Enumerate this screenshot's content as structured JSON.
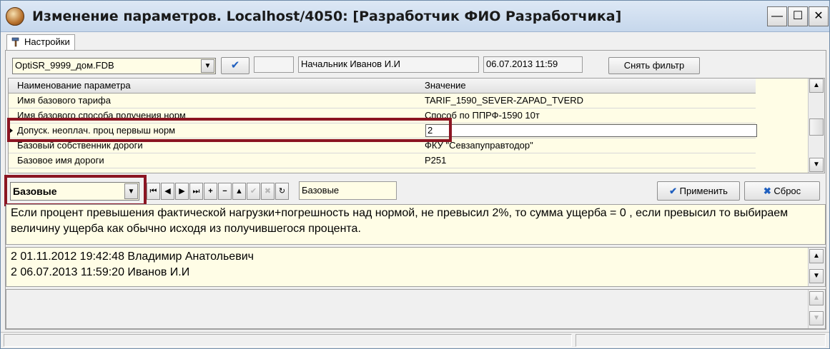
{
  "window": {
    "title": "Изменение параметров. Localhost/4050: [Разработчик ФИО Разработчика]",
    "minimize_glyph": "—",
    "maximize_glyph": "☐",
    "close_glyph": "✕"
  },
  "tabs": [
    {
      "label": "Настройки",
      "icon": "hammer-icon"
    }
  ],
  "toolbar": {
    "database_select": "OptiSR_9999_дом.FDB",
    "confirm_glyph": "✔",
    "empty_field": "",
    "user_field": "Начальник Иванов И.И",
    "datetime_field": "06.07.2013 11:59",
    "remove_filter_label": "Снять фильтр"
  },
  "grid": {
    "columns": [
      "Наименование параметра",
      "Значение"
    ],
    "rows": [
      {
        "name": "Имя базового тарифа",
        "value": "TARIF_1590_SEVER-ZAPAD_TVERD"
      },
      {
        "name": "Имя базового способа получения норм",
        "value": "Способ по ППРФ-1590 10т"
      },
      {
        "name": "Допуск. неоплач. проц первыш норм",
        "value": "2",
        "selected": true
      },
      {
        "name": "Базовый собственник дороги",
        "value": "ФКУ \"Севзапуправтодор\""
      },
      {
        "name": "Базовое имя дороги",
        "value": "Р251"
      }
    ]
  },
  "bottom_toolbar": {
    "group_select": "Базовые",
    "nav_buttons": [
      {
        "name": "first-record-button",
        "glyph": "⏮",
        "enabled": true
      },
      {
        "name": "prior-record-button",
        "glyph": "◀",
        "enabled": true
      },
      {
        "name": "next-record-button",
        "glyph": "▶",
        "enabled": true
      },
      {
        "name": "last-record-button",
        "glyph": "⏭",
        "enabled": true
      },
      {
        "name": "insert-record-button",
        "glyph": "+",
        "enabled": true
      },
      {
        "name": "delete-record-button",
        "glyph": "−",
        "enabled": true
      },
      {
        "name": "edit-record-button",
        "glyph": "▲",
        "enabled": true
      },
      {
        "name": "post-record-button",
        "glyph": "✔",
        "enabled": false
      },
      {
        "name": "cancel-record-button",
        "glyph": "✖",
        "enabled": false
      },
      {
        "name": "refresh-button",
        "glyph": "↻",
        "enabled": true
      }
    ],
    "group_field": "Базовые",
    "apply_label": "Применить",
    "reset_label": "Сброс"
  },
  "description": "Если процент превышения фактической нагрузки+погрешность над нормой, не превысил 2%, то сумма ущерба = 0 , если превысил то выбираем величину ущерба как обычно исходя из получившегося процента.",
  "history": [
    "2 01.11.2012 19:42:48 Владимир Анатольевич",
    "2 06.07.2013 11:59:20 Иванов И.И"
  ],
  "colors": {
    "accent_highlight": "#8b1522",
    "field_background": "#fffde6",
    "apply_check": "#1f5fbf",
    "reset_x": "#1f5fbf"
  }
}
